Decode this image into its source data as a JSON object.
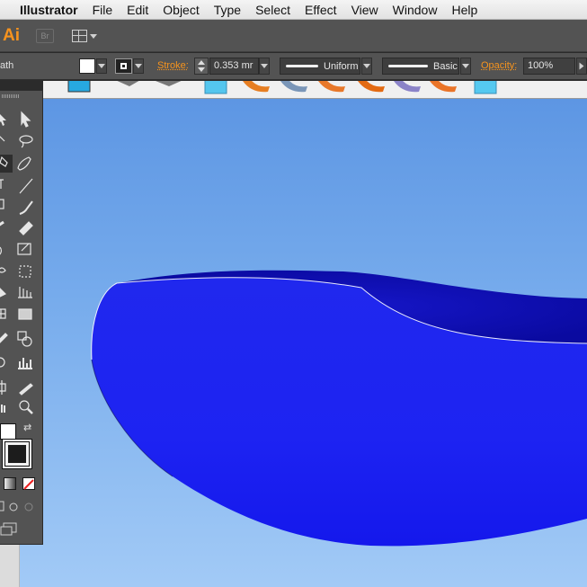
{
  "menubar": {
    "app_name": "Illustrator",
    "items": [
      "File",
      "Edit",
      "Object",
      "Type",
      "Select",
      "Effect",
      "View",
      "Window",
      "Help"
    ]
  },
  "appbar": {
    "logo_text": "Ai",
    "bridge_label": "Br",
    "workspace_icon": "arrange-documents-icon"
  },
  "controlbar": {
    "selection_label": "ath",
    "fill_color": "#ffffff",
    "stroke_label": "Stroke:",
    "stroke_value": "0.353 mr",
    "profile_label": "Uniform",
    "brush_label": "Basic",
    "opacity_label": "Opacity:",
    "opacity_value": "100%"
  },
  "tools": {
    "items": [
      "direct-selection-icon",
      "selection-icon",
      "lasso-icon",
      "magic-wand-icon",
      "pen-icon",
      "type-icon",
      "line-icon",
      "rectangle-icon",
      "paintbrush-icon",
      "blob-brush-icon",
      "rotate-icon",
      "scale-icon",
      "width-icon",
      "free-transform-icon",
      "shape-builder-icon",
      "perspective-grid-icon",
      "mesh-icon",
      "gradient-icon",
      "eyedropper-icon",
      "blend-icon",
      "symbol-sprayer-icon",
      "graph-icon",
      "artboard-icon",
      "slice-icon",
      "hand-icon",
      "zoom-icon"
    ],
    "swap_icon": "swap-fill-stroke-icon"
  },
  "colors": {
    "app_chrome": "#535353",
    "accent_orange": "#f7941d",
    "canvas_top": "#5d96e3",
    "canvas_bottom": "#a2caf6",
    "shape_blue": "#1a1ef0"
  }
}
